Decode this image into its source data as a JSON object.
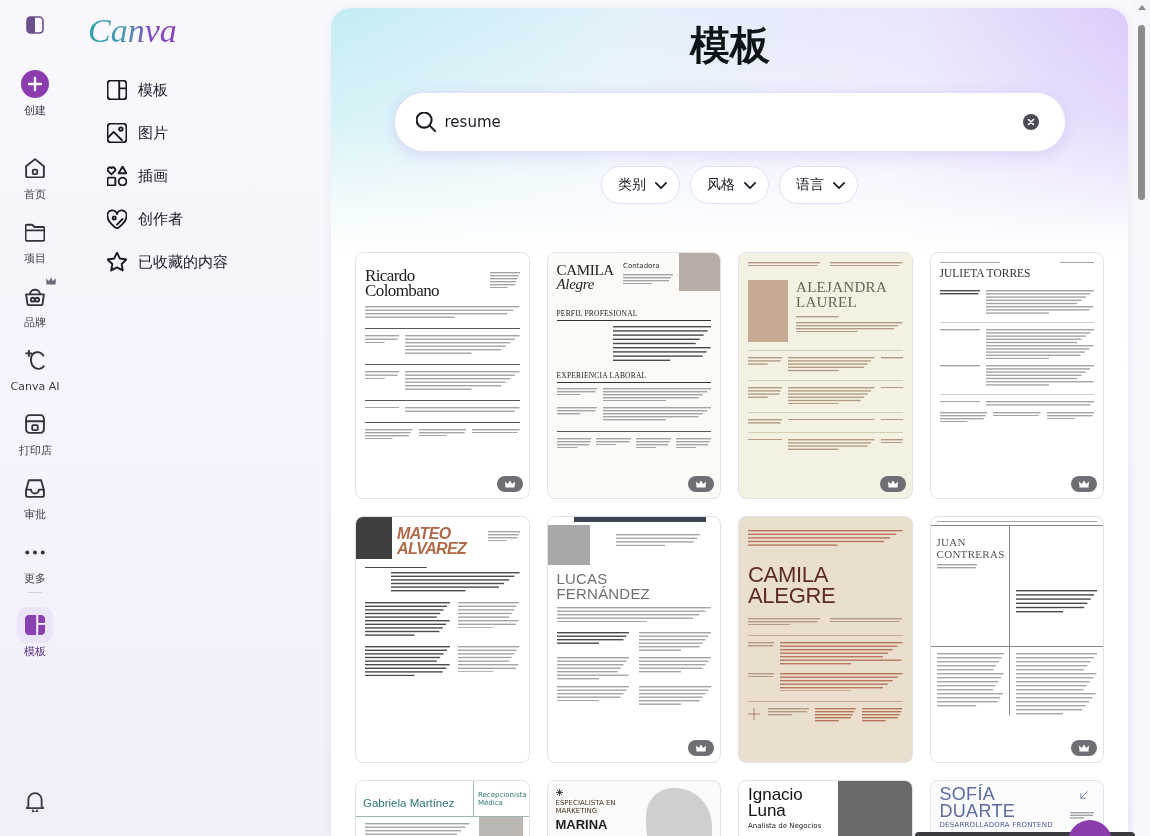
{
  "rail": {
    "items": [
      {
        "label": "创建",
        "kind": "create",
        "selected": false,
        "premium": false
      },
      {
        "label": "首页",
        "kind": "nav",
        "selected": false,
        "premium": false
      },
      {
        "label": "项目",
        "kind": "nav",
        "selected": false,
        "premium": false
      },
      {
        "label": "品牌",
        "kind": "nav",
        "selected": false,
        "premium": true
      },
      {
        "label": "Canva AI",
        "kind": "nav",
        "selected": false,
        "premium": false
      },
      {
        "label": "打印店",
        "kind": "nav",
        "selected": false,
        "premium": false
      },
      {
        "label": "审批",
        "kind": "nav",
        "selected": false,
        "premium": false
      },
      {
        "label": "更多",
        "kind": "nav",
        "selected": false,
        "premium": false
      },
      {
        "label": "模板",
        "kind": "app",
        "selected": true,
        "premium": false
      }
    ]
  },
  "sidebar": {
    "logo": "Canva",
    "items": [
      {
        "label": "模板",
        "selected": false
      },
      {
        "label": "图片",
        "selected": false
      },
      {
        "label": "插画",
        "selected": false
      },
      {
        "label": "创作者",
        "selected": false
      },
      {
        "label": "已收藏的内容",
        "selected": false
      }
    ]
  },
  "header": {
    "title": "模板",
    "search": {
      "value": "resume"
    },
    "filters": [
      {
        "label": "类别"
      },
      {
        "label": "风格"
      },
      {
        "label": "语言"
      }
    ]
  },
  "templates": [
    {
      "kind": "serif-classic",
      "name": "Ricardo\nColombano",
      "premium": true
    },
    {
      "kind": "photo-right",
      "name": "CAMILA\n*Alegre*",
      "role": "Contadora",
      "sections": [
        "PERFIL PROFESIONAL",
        "EXPERIENCIA LABORAL"
      ],
      "premium": true
    },
    {
      "kind": "cream-photo",
      "name": "ALEJANDRA\nLAUREL",
      "premium": true
    },
    {
      "kind": "minimal",
      "name": "JULIETA TORRES",
      "premium": true
    },
    {
      "kind": "bold-italic",
      "name": "MATEO\nALVAREZ",
      "premium": false
    },
    {
      "kind": "photo-left",
      "name": "LUCAS\nFERNÁNDEZ",
      "premium": true
    },
    {
      "kind": "beige-big",
      "name": "CAMILA\nALEGRE",
      "premium": false
    },
    {
      "kind": "grid-serif",
      "name": "JUAN\nCONTRERAS",
      "premium": true
    },
    {
      "kind": "teal-header",
      "name": "Gabriela Martínez",
      "role": "Recepcionista\nMédica"
    },
    {
      "kind": "cutout",
      "tagline": "ESPECIALISTA EN\nMARKETING",
      "name": "MARINA"
    },
    {
      "kind": "photo-right-bold",
      "name": "Ignacio\nLuna",
      "role": "Analista de Negocios"
    },
    {
      "kind": "slate",
      "name": "SOFÍA\nDUARTE",
      "role": "DESARROLLADORA FRONTEND"
    }
  ]
}
